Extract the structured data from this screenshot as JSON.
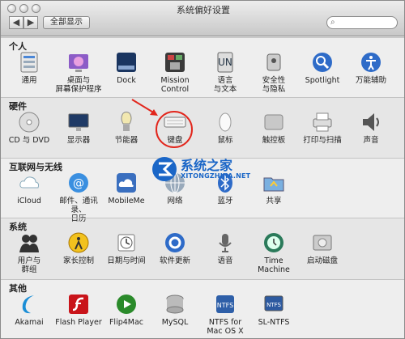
{
  "window": {
    "title": "系统偏好设置",
    "show_all": "全部显示",
    "back": "◀",
    "forward": "▶"
  },
  "sections": [
    {
      "title": "个人",
      "items": [
        {
          "label": "通用",
          "icon": "general-icon"
        },
        {
          "label": "桌面与\n屏幕保护程序",
          "icon": "desktop-screensaver-icon"
        },
        {
          "label": "Dock",
          "icon": "dock-icon"
        },
        {
          "label": "Mission\nControl",
          "icon": "mission-control-icon"
        },
        {
          "label": "语言\n与文本",
          "icon": "language-text-icon"
        },
        {
          "label": "安全性\n与隐私",
          "icon": "security-privacy-icon"
        },
        {
          "label": "Spotlight",
          "icon": "spotlight-icon"
        },
        {
          "label": "万能辅助",
          "icon": "universal-access-icon"
        }
      ]
    },
    {
      "title": "硬件",
      "items": [
        {
          "label": "CD 与 DVD",
          "icon": "cd-dvd-icon"
        },
        {
          "label": "显示器",
          "icon": "display-icon"
        },
        {
          "label": "节能器",
          "icon": "energy-saver-icon"
        },
        {
          "label": "键盘",
          "icon": "keyboard-icon"
        },
        {
          "label": "鼠标",
          "icon": "mouse-icon"
        },
        {
          "label": "触控板",
          "icon": "trackpad-icon"
        },
        {
          "label": "打印与扫描",
          "icon": "print-scan-icon"
        },
        {
          "label": "声音",
          "icon": "sound-icon"
        }
      ]
    },
    {
      "title": "互联网与无线",
      "items": [
        {
          "label": "iCloud",
          "icon": "icloud-icon"
        },
        {
          "label": "邮件、通讯录、\n日历",
          "icon": "mail-contacts-calendar-icon"
        },
        {
          "label": "MobileMe",
          "icon": "mobileme-icon"
        },
        {
          "label": "网络",
          "icon": "network-icon"
        },
        {
          "label": "蓝牙",
          "icon": "bluetooth-icon"
        },
        {
          "label": "共享",
          "icon": "sharing-icon"
        }
      ]
    },
    {
      "title": "系统",
      "items": [
        {
          "label": "用户与\n群组",
          "icon": "users-groups-icon"
        },
        {
          "label": "家长控制",
          "icon": "parental-controls-icon"
        },
        {
          "label": "日期与时间",
          "icon": "date-time-icon"
        },
        {
          "label": "软件更新",
          "icon": "software-update-icon"
        },
        {
          "label": "语音",
          "icon": "speech-icon"
        },
        {
          "label": "Time Machine",
          "icon": "time-machine-icon"
        },
        {
          "label": "启动磁盘",
          "icon": "startup-disk-icon"
        }
      ]
    },
    {
      "title": "其他",
      "items": [
        {
          "label": "Akamai",
          "icon": "akamai-icon"
        },
        {
          "label": "Flash Player",
          "icon": "flash-player-icon"
        },
        {
          "label": "Flip4Mac",
          "icon": "flip4mac-icon"
        },
        {
          "label": "MySQL",
          "icon": "mysql-icon"
        },
        {
          "label": "NTFS for\nMac OS X",
          "icon": "ntfs-for-mac-icon"
        },
        {
          "label": "SL-NTFS",
          "icon": "sl-ntfs-icon"
        }
      ]
    }
  ],
  "watermark": {
    "cn": "系统之家",
    "en": "XITONGZHIJIA.NET"
  },
  "colors": {
    "highlight_circle": "#e2261c",
    "watermark": "#1a66c7"
  }
}
